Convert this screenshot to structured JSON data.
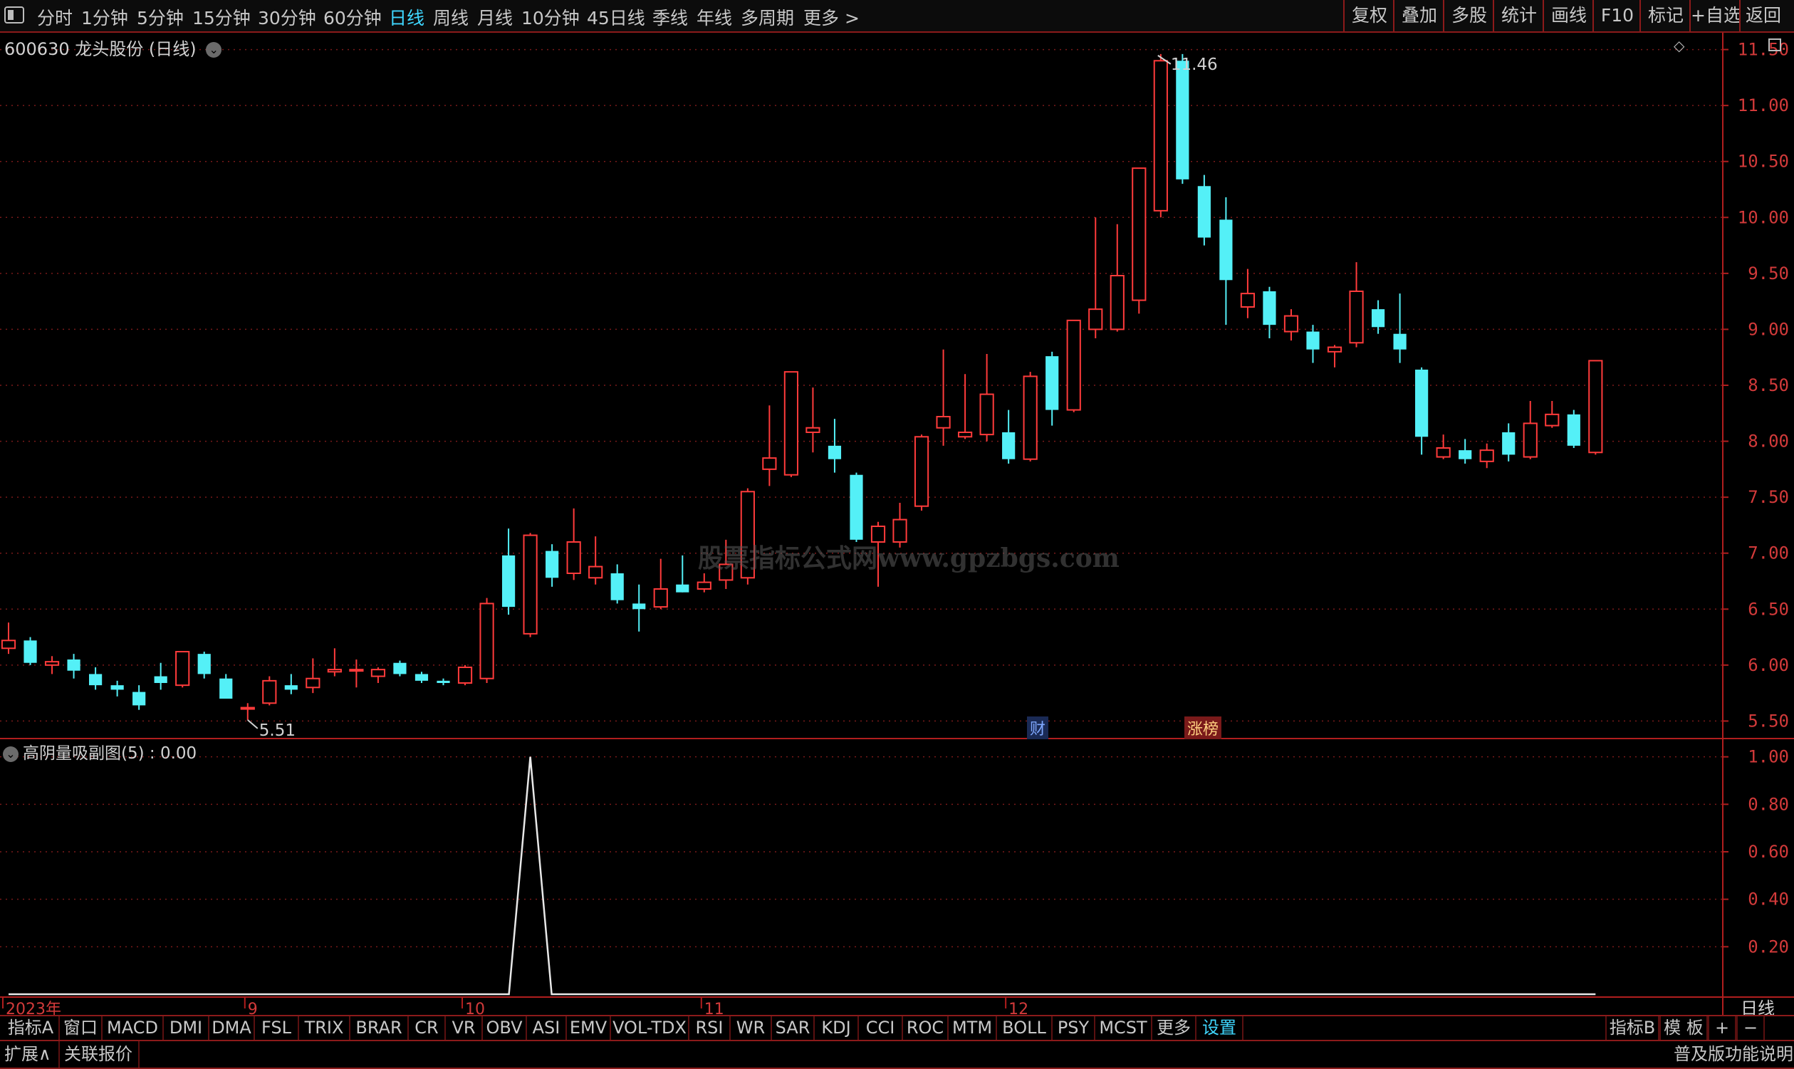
{
  "toolbar": {
    "periods": [
      "分时",
      "1分钟",
      "5分钟",
      "15分钟",
      "30分钟",
      "60分钟",
      "日线",
      "周线",
      "月线",
      "10分钟",
      "45日线",
      "季线",
      "年线",
      "多周期",
      "更多 >"
    ],
    "active_period": "日线",
    "right_buttons": [
      "复权",
      "叠加",
      "多股",
      "统计",
      "画线",
      "F10",
      "标记",
      "+自选",
      "返回"
    ]
  },
  "stock": {
    "code": "600630",
    "name": "龙头股份",
    "period_label": "(日线)",
    "title": "600630 龙头股份 (日线)"
  },
  "watermark": "股票指标公式网www.gpzbgs.com",
  "events": {
    "cai": "财",
    "zhangbang": "涨榜"
  },
  "price_axis": {
    "ticks": [
      "11.50",
      "11.00",
      "10.50",
      "10.00",
      "9.50",
      "9.00",
      "8.50",
      "8.00",
      "7.50",
      "7.00",
      "6.50",
      "6.00",
      "5.50"
    ],
    "high_label": "11.46",
    "low_label": "5.51"
  },
  "indicator": {
    "title": "高阴量吸副图(5) : 0.00",
    "ticks": [
      "1.00",
      "0.80",
      "0.60",
      "0.40",
      "0.20"
    ]
  },
  "time_axis": {
    "labels": [
      "2023年",
      "9",
      "10",
      "11",
      "12"
    ],
    "period_button": "日线"
  },
  "tabs": [
    "指标A",
    "窗口",
    "MACD",
    "DMI",
    "DMA",
    "FSL",
    "TRIX",
    "BRAR",
    "CR",
    "VR",
    "OBV",
    "ASI",
    "EMV",
    "VOL-TDX",
    "RSI",
    "WR",
    "SAR",
    "KDJ",
    "CCI",
    "ROC",
    "MTM",
    "BOLL",
    "PSY",
    "MCST",
    "更多",
    "设置"
  ],
  "tabs_right": [
    "指标B",
    "模 板",
    "+",
    "−"
  ],
  "status": {
    "expand": "扩展∧",
    "related": "关联报价",
    "edition": "普及版功能说明"
  },
  "colors": {
    "up": "#ff3b3b",
    "down": "#54f0f7",
    "grid": "#7a1a1a",
    "axis": "#b01e1e"
  },
  "chart_data": {
    "type": "candlestick",
    "title": "600630 龙头股份 (日线)",
    "ylim": [
      5.35,
      11.65
    ],
    "max_label": 11.46,
    "min_label": 5.51,
    "candles": [
      {
        "o": 6.15,
        "h": 6.38,
        "l": 6.1,
        "c": 6.22
      },
      {
        "o": 6.22,
        "h": 6.25,
        "l": 6.0,
        "c": 6.02
      },
      {
        "o": 6.0,
        "h": 6.08,
        "l": 5.92,
        "c": 6.03
      },
      {
        "o": 6.05,
        "h": 6.1,
        "l": 5.88,
        "c": 5.95
      },
      {
        "o": 5.92,
        "h": 5.98,
        "l": 5.78,
        "c": 5.82
      },
      {
        "o": 5.82,
        "h": 5.86,
        "l": 5.72,
        "c": 5.78
      },
      {
        "o": 5.76,
        "h": 5.82,
        "l": 5.6,
        "c": 5.64
      },
      {
        "o": 5.9,
        "h": 6.02,
        "l": 5.78,
        "c": 5.84
      },
      {
        "o": 5.82,
        "h": 6.12,
        "l": 5.8,
        "c": 6.12
      },
      {
        "o": 6.1,
        "h": 6.12,
        "l": 5.88,
        "c": 5.92
      },
      {
        "o": 5.88,
        "h": 5.92,
        "l": 5.7,
        "c": 5.7
      },
      {
        "o": 5.62,
        "h": 5.66,
        "l": 5.51,
        "c": 5.62
      },
      {
        "o": 5.66,
        "h": 5.9,
        "l": 5.64,
        "c": 5.86
      },
      {
        "o": 5.82,
        "h": 5.92,
        "l": 5.74,
        "c": 5.78
      },
      {
        "o": 5.8,
        "h": 6.06,
        "l": 5.75,
        "c": 5.88
      },
      {
        "o": 5.94,
        "h": 6.15,
        "l": 5.9,
        "c": 5.96
      },
      {
        "o": 5.96,
        "h": 6.05,
        "l": 5.8,
        "c": 5.96
      },
      {
        "o": 5.9,
        "h": 5.98,
        "l": 5.84,
        "c": 5.96
      },
      {
        "o": 6.02,
        "h": 6.04,
        "l": 5.9,
        "c": 5.92
      },
      {
        "o": 5.92,
        "h": 5.94,
        "l": 5.84,
        "c": 5.86
      },
      {
        "o": 5.86,
        "h": 5.88,
        "l": 5.82,
        "c": 5.84
      },
      {
        "o": 5.84,
        "h": 6.0,
        "l": 5.82,
        "c": 5.98
      },
      {
        "o": 5.88,
        "h": 6.6,
        "l": 5.84,
        "c": 6.55
      },
      {
        "o": 6.98,
        "h": 7.22,
        "l": 6.45,
        "c": 6.52
      },
      {
        "o": 6.28,
        "h": 7.18,
        "l": 6.25,
        "c": 7.16
      },
      {
        "o": 7.02,
        "h": 7.08,
        "l": 6.7,
        "c": 6.78
      },
      {
        "o": 6.82,
        "h": 7.4,
        "l": 6.76,
        "c": 7.1
      },
      {
        "o": 6.78,
        "h": 7.15,
        "l": 6.72,
        "c": 6.88
      },
      {
        "o": 6.82,
        "h": 6.9,
        "l": 6.55,
        "c": 6.58
      },
      {
        "o": 6.55,
        "h": 6.72,
        "l": 6.3,
        "c": 6.5
      },
      {
        "o": 6.52,
        "h": 6.95,
        "l": 6.5,
        "c": 6.68
      },
      {
        "o": 6.72,
        "h": 6.98,
        "l": 6.65,
        "c": 6.65
      },
      {
        "o": 6.68,
        "h": 6.82,
        "l": 6.65,
        "c": 6.74
      },
      {
        "o": 6.76,
        "h": 7.12,
        "l": 6.68,
        "c": 6.9
      },
      {
        "o": 6.78,
        "h": 7.58,
        "l": 6.72,
        "c": 7.55
      },
      {
        "o": 7.75,
        "h": 8.32,
        "l": 7.6,
        "c": 7.85
      },
      {
        "o": 7.7,
        "h": 8.62,
        "l": 7.68,
        "c": 8.62
      },
      {
        "o": 8.08,
        "h": 8.48,
        "l": 7.9,
        "c": 8.12
      },
      {
        "o": 7.96,
        "h": 8.2,
        "l": 7.72,
        "c": 7.84
      },
      {
        "o": 7.7,
        "h": 7.72,
        "l": 7.1,
        "c": 7.12
      },
      {
        "o": 7.1,
        "h": 7.28,
        "l": 6.7,
        "c": 7.24
      },
      {
        "o": 7.1,
        "h": 7.45,
        "l": 7.05,
        "c": 7.3
      },
      {
        "o": 7.42,
        "h": 8.06,
        "l": 7.38,
        "c": 8.04
      },
      {
        "o": 8.12,
        "h": 8.82,
        "l": 7.96,
        "c": 8.22
      },
      {
        "o": 8.04,
        "h": 8.6,
        "l": 8.02,
        "c": 8.08
      },
      {
        "o": 8.06,
        "h": 8.78,
        "l": 8.0,
        "c": 8.42
      },
      {
        "o": 8.08,
        "h": 8.28,
        "l": 7.8,
        "c": 7.84
      },
      {
        "o": 7.84,
        "h": 8.62,
        "l": 7.82,
        "c": 8.58
      },
      {
        "o": 8.76,
        "h": 8.8,
        "l": 8.14,
        "c": 8.28
      },
      {
        "o": 8.28,
        "h": 9.08,
        "l": 8.26,
        "c": 9.08
      },
      {
        "o": 9.0,
        "h": 10.0,
        "l": 8.92,
        "c": 9.18
      },
      {
        "o": 9.0,
        "h": 9.94,
        "l": 8.98,
        "c": 9.48
      },
      {
        "o": 9.26,
        "h": 10.44,
        "l": 9.14,
        "c": 10.44
      },
      {
        "o": 10.06,
        "h": 11.46,
        "l": 10.0,
        "c": 11.4
      },
      {
        "o": 11.4,
        "h": 11.46,
        "l": 10.3,
        "c": 10.34
      },
      {
        "o": 10.28,
        "h": 10.38,
        "l": 9.75,
        "c": 9.82
      },
      {
        "o": 9.98,
        "h": 10.18,
        "l": 9.04,
        "c": 9.44
      },
      {
        "o": 9.2,
        "h": 9.54,
        "l": 9.1,
        "c": 9.32
      },
      {
        "o": 9.34,
        "h": 9.38,
        "l": 8.92,
        "c": 9.04
      },
      {
        "o": 8.98,
        "h": 9.18,
        "l": 8.9,
        "c": 9.12
      },
      {
        "o": 8.98,
        "h": 9.04,
        "l": 8.7,
        "c": 8.82
      },
      {
        "o": 8.8,
        "h": 8.86,
        "l": 8.66,
        "c": 8.84
      },
      {
        "o": 8.88,
        "h": 9.6,
        "l": 8.84,
        "c": 9.34
      },
      {
        "o": 9.18,
        "h": 9.26,
        "l": 8.96,
        "c": 9.02
      },
      {
        "o": 8.96,
        "h": 9.32,
        "l": 8.7,
        "c": 8.82
      },
      {
        "o": 8.64,
        "h": 8.66,
        "l": 7.88,
        "c": 8.04
      },
      {
        "o": 7.86,
        "h": 8.06,
        "l": 7.84,
        "c": 7.94
      },
      {
        "o": 7.92,
        "h": 8.02,
        "l": 7.8,
        "c": 7.84
      },
      {
        "o": 7.82,
        "h": 7.98,
        "l": 7.76,
        "c": 7.92
      },
      {
        "o": 8.08,
        "h": 8.16,
        "l": 7.82,
        "c": 7.88
      },
      {
        "o": 7.86,
        "h": 8.36,
        "l": 7.84,
        "c": 8.16
      },
      {
        "o": 8.14,
        "h": 8.36,
        "l": 8.12,
        "c": 8.24
      },
      {
        "o": 8.24,
        "h": 8.28,
        "l": 7.94,
        "c": 7.96
      },
      {
        "o": 7.9,
        "h": 8.72,
        "l": 7.88,
        "c": 8.72
      }
    ],
    "indicator": {
      "name": "高阴量吸副图(5)",
      "ylim": [
        0,
        1.05
      ],
      "values_note": "zero everywhere except a single spike of 1.00 at bar index 24",
      "spike_index": 24,
      "spike_value": 1.0
    }
  }
}
